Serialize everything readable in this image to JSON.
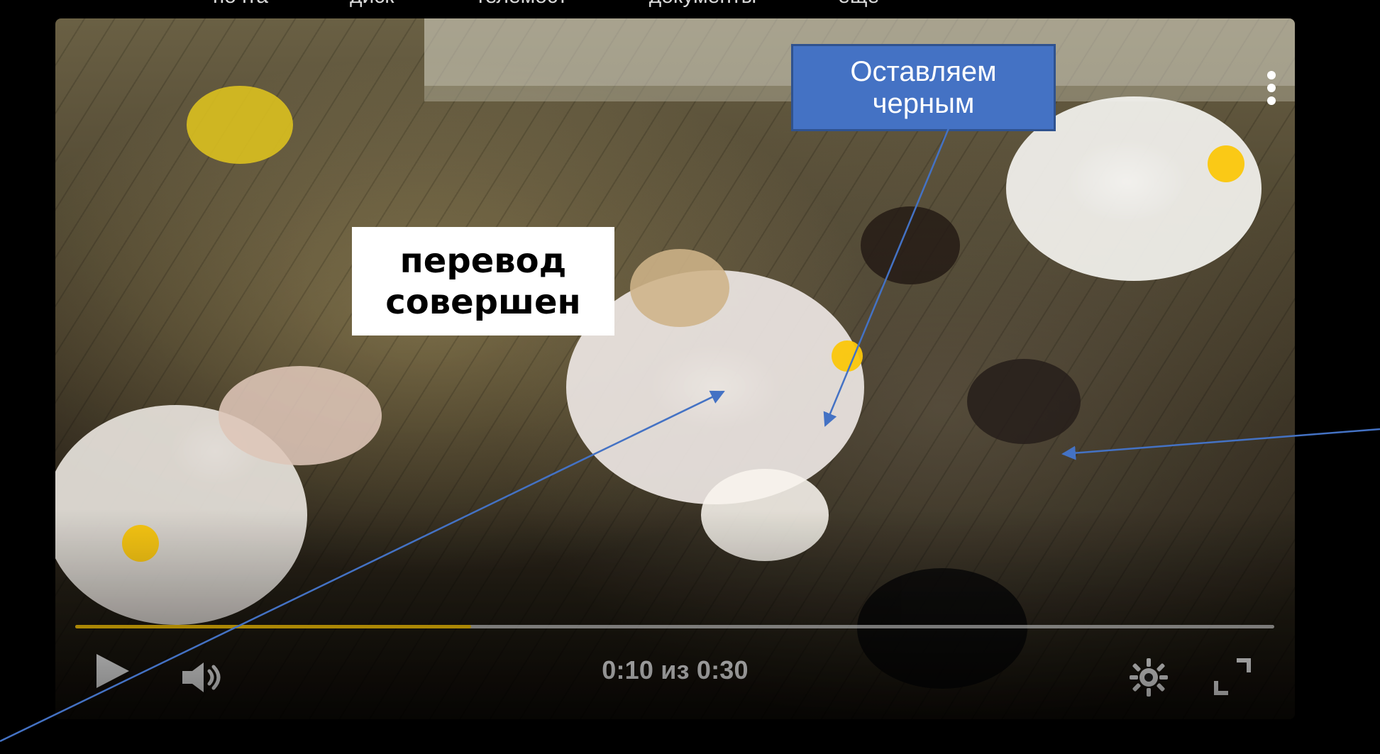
{
  "top_nav": {
    "items": [
      {
        "label": "почта"
      },
      {
        "label": "диск"
      },
      {
        "label": "телемост"
      },
      {
        "label": "документы"
      },
      {
        "label": "ещё"
      }
    ]
  },
  "video": {
    "caption": "перевод\nсовершен",
    "time_text": "0:10 из 0:30",
    "progress_fraction": 0.33,
    "accent_color": "#f2c318",
    "icons": {
      "more": "more-vertical-icon",
      "play": "play-icon",
      "volume": "volume-icon",
      "settings": "gear-icon",
      "fullscreen": "fullscreen-icon"
    }
  },
  "annotation": {
    "callout_text": "Оставляем\nчерным",
    "callout_fill": "#4472c4",
    "callout_border": "#2f528f",
    "arrow_color": "#4472c4"
  }
}
